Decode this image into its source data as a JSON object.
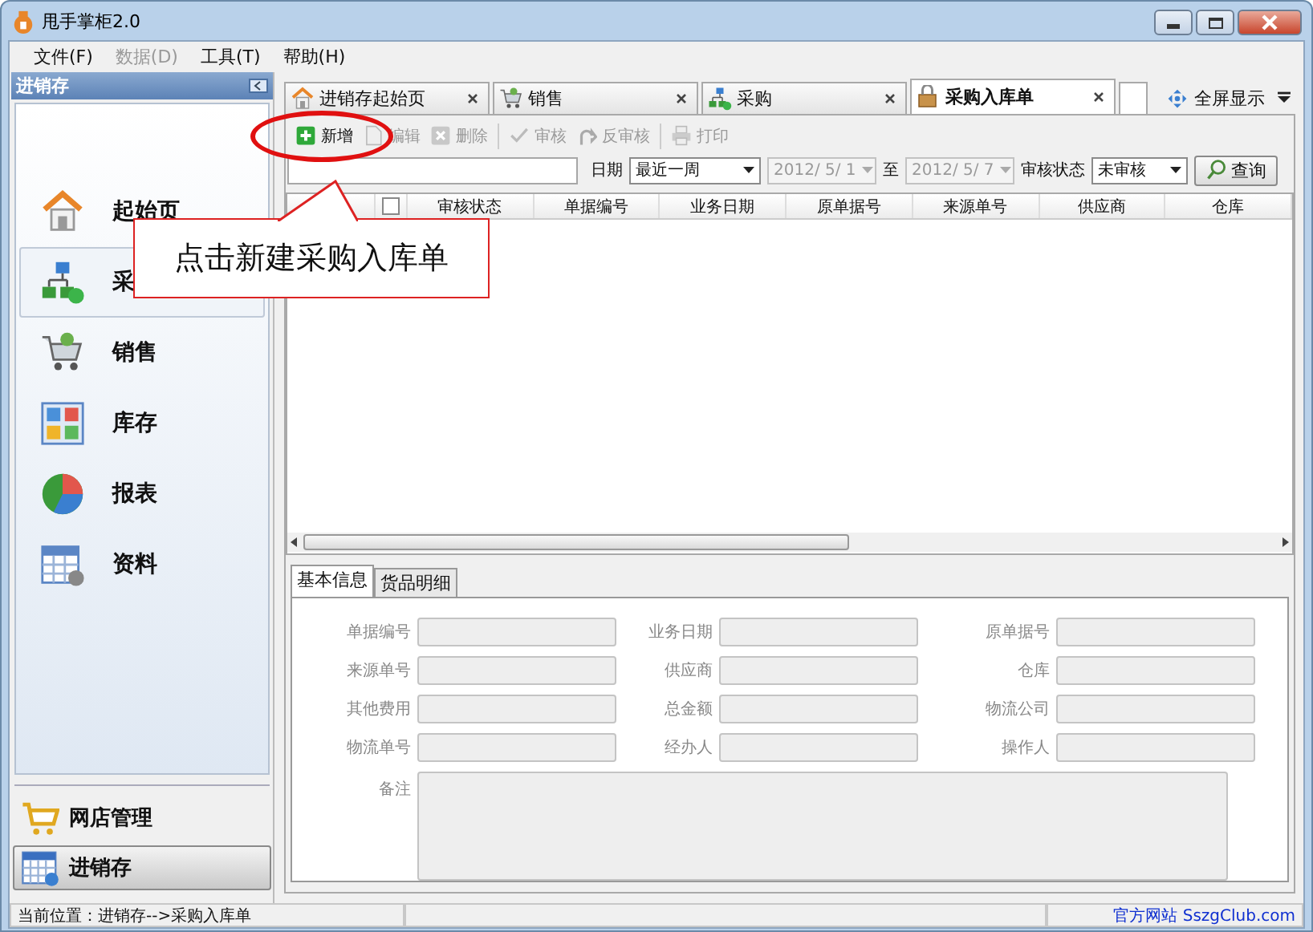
{
  "window": {
    "title": "甩手掌柜2.0"
  },
  "menu": [
    {
      "label": "文件(F)",
      "disabled": false
    },
    {
      "label": "数据(D)",
      "disabled": true
    },
    {
      "label": "工具(T)",
      "disabled": false
    },
    {
      "label": "帮助(H)",
      "disabled": false
    }
  ],
  "sidebar": {
    "title": "进销存",
    "items": [
      {
        "label": "起始页",
        "selected": false
      },
      {
        "label": "采",
        "selected": true
      },
      {
        "label": "销售",
        "selected": false
      },
      {
        "label": "库存",
        "selected": false
      },
      {
        "label": "报表",
        "selected": false
      },
      {
        "label": "资料",
        "selected": false
      }
    ],
    "modules": [
      {
        "label": "网店管理",
        "selected": false
      },
      {
        "label": "进销存",
        "selected": true
      }
    ]
  },
  "tabs": [
    {
      "label": "进销存起始页",
      "selected": false
    },
    {
      "label": "销售",
      "selected": false
    },
    {
      "label": "采购",
      "selected": false
    },
    {
      "label": "采购入库单",
      "selected": true
    }
  ],
  "fullscreen": "全屏显示",
  "toolbar": [
    {
      "label": "新增",
      "disabled": false
    },
    {
      "label": "编辑",
      "disabled": true
    },
    {
      "label": "删除",
      "disabled": true
    },
    {
      "label": "审核",
      "disabled": true
    },
    {
      "label": "反审核",
      "disabled": true
    },
    {
      "label": "打印",
      "disabled": true
    }
  ],
  "filter": {
    "date_label": "日期",
    "period": "最近一周",
    "from": "2012/ 5/ 1",
    "to_label": "至",
    "to": "2012/ 5/ 7",
    "status_label": "审核状态",
    "status": "未审核",
    "query": "查询"
  },
  "table": {
    "select_all": {
      "checked": false
    },
    "columns": [
      "审核状态",
      "单据编号",
      "业务日期",
      "原单据号",
      "来源单号",
      "供应商",
      "仓库"
    ]
  },
  "detail_tabs": [
    {
      "label": "基本信息",
      "selected": true
    },
    {
      "label": "货品明细",
      "selected": false
    }
  ],
  "form": {
    "fields": [
      "单据编号",
      "业务日期",
      "原单据号",
      "来源单号",
      "供应商",
      "仓库",
      "其他费用",
      "总金额",
      "物流公司",
      "物流单号",
      "经办人",
      "操作人"
    ],
    "notes_label": "备注"
  },
  "callout": "点击新建采购入库单",
  "status_bar": {
    "location": "当前位置：进销存-->采购入库单",
    "link": "官方网站 SszgClub.com"
  }
}
